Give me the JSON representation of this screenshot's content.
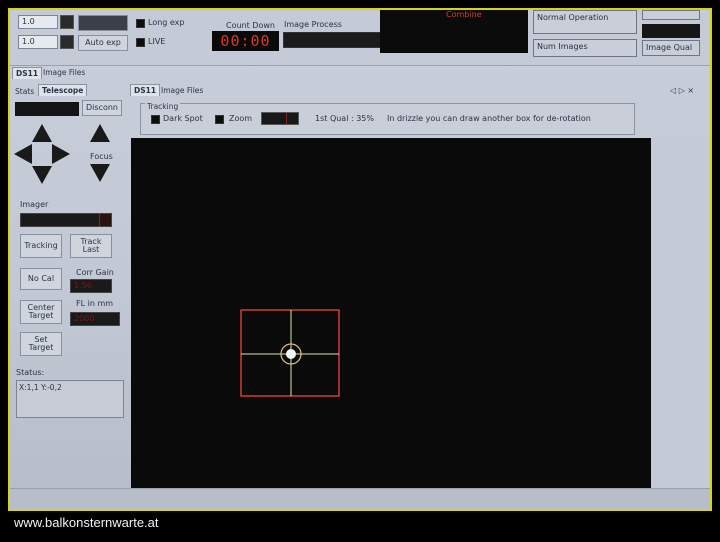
{
  "topbar": {
    "field_a_value": "1.0",
    "field_b_value": "1.0",
    "auto_exp_label": "Auto exp",
    "long_exp_label": "Long exp",
    "live_label": "LIVE",
    "countdown_label": "Count Down",
    "countdown_value": "00:00",
    "image_process_label": "Image Process",
    "combine_label": "Combine",
    "normal_operation": "Normal Operation",
    "num_images_label": "Num Images",
    "image_qual_label": "Image Qual"
  },
  "outer_tabs": [
    "DS11",
    "Image Files"
  ],
  "left_tabs": [
    "Stats",
    "Telescope"
  ],
  "main_tabs": [
    "DS11",
    "Image Files"
  ],
  "nav_glyphs": "◁ ▷ ×",
  "telescope": {
    "disconn_label": "Disconn",
    "focus_label": "Focus",
    "imager_label": "Imager",
    "tracking_button": "Tracking",
    "track_last_button": "Track Last",
    "no_cal_button": "No Cal",
    "corr_gain_label": "Corr Gain",
    "corr_gain_value": "1.56",
    "fl_label": "FL in mm",
    "fl_value": "2000",
    "center_target_button": "Center Target",
    "set_target_button": "Set Target",
    "status_label": "Status:",
    "status_value": "X:1,1 Y:-0,2"
  },
  "tracking": {
    "group_title": "Tracking",
    "dark_spot_label": "Dark Spot",
    "zoom_label": "Zoom",
    "qual_text": "1st Qual : 35%",
    "hint_text": "In drizzle you can draw another box for de-rotation"
  },
  "footer": {
    "url": "www.balkonsternwarte.at"
  },
  "colors": {
    "frame": "#d8d21a",
    "reticle_box": "#e0412e",
    "crosshair": "#d8e8a8",
    "timer": "#d8381e"
  }
}
